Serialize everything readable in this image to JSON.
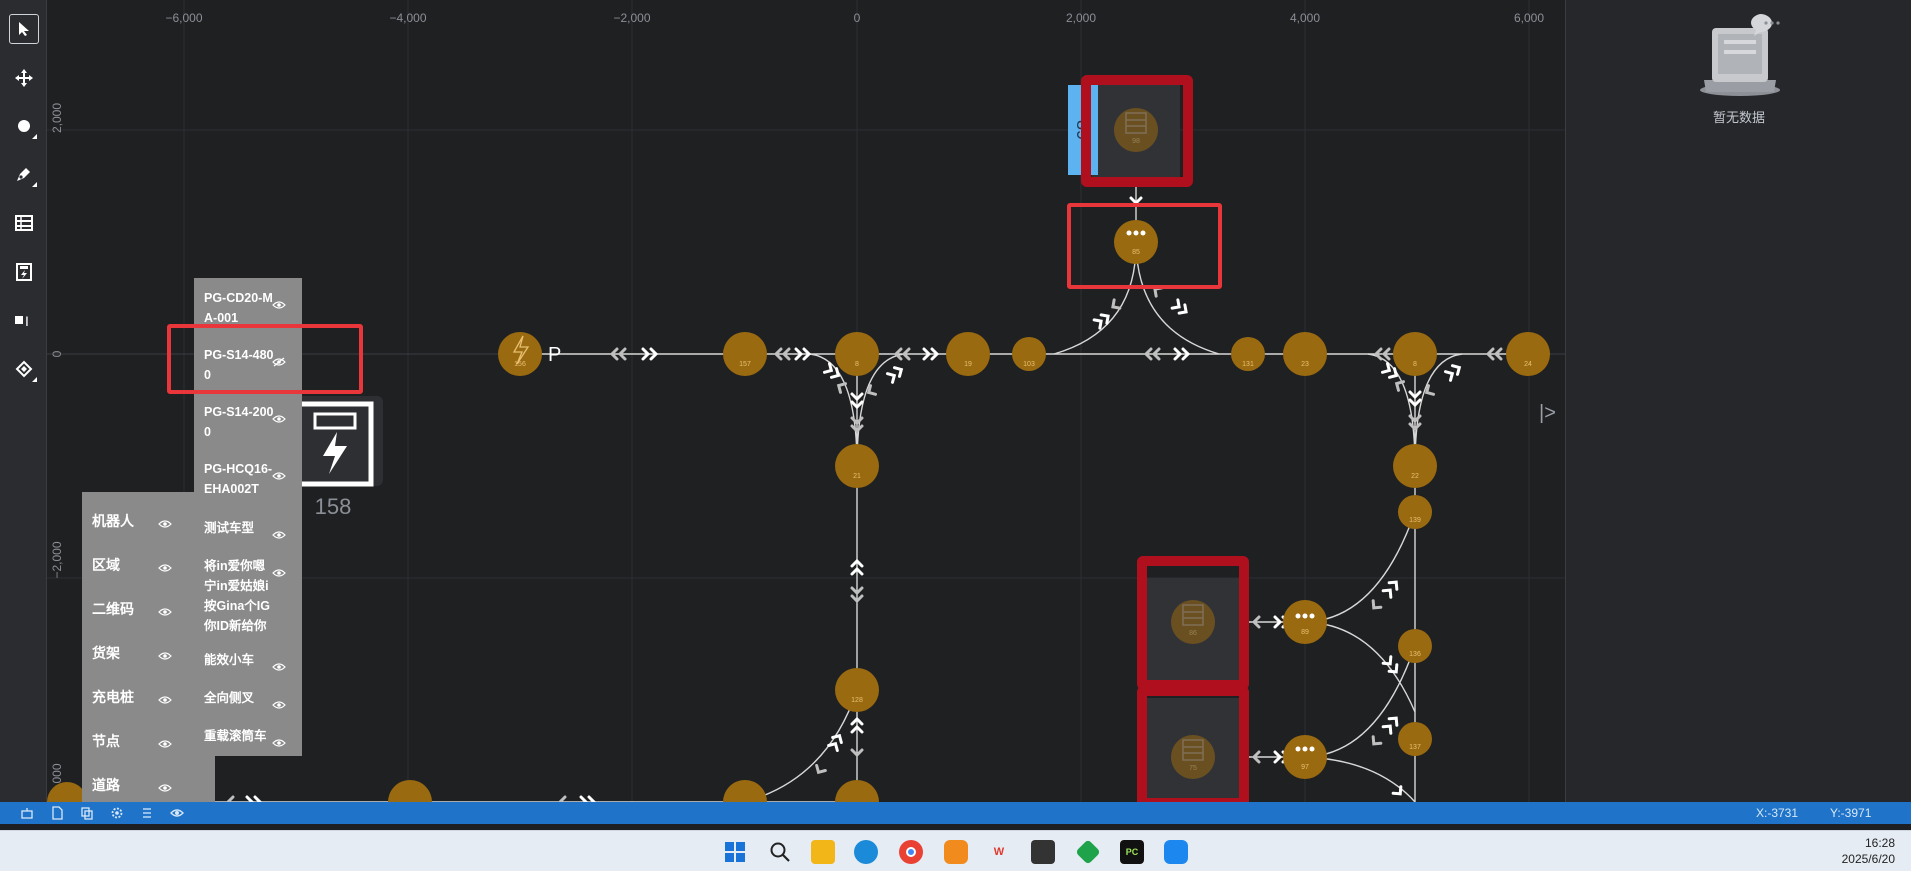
{
  "axes": {
    "x_ticks": [
      "−6,000",
      "−4,000",
      "−2,000",
      "0",
      "2,000",
      "4,000",
      "6,000"
    ],
    "y_ticks": [
      "2,000",
      "0",
      "−2,000",
      "−4,000"
    ]
  },
  "toolbar": {
    "tools": [
      "select-tool",
      "pan-tool",
      "point-tool",
      "pen-tool",
      "shelf-tool",
      "charger-tool",
      "label-tool",
      "area-tool"
    ]
  },
  "map": {
    "nodes": [
      {
        "label": "156",
        "icon": "charging-icon"
      },
      {
        "label": "157"
      },
      {
        "label": "8"
      },
      {
        "label": "19"
      },
      {
        "label": "103"
      },
      {
        "label": "131"
      },
      {
        "label": "23"
      },
      {
        "label": "8"
      },
      {
        "label": "24"
      },
      {
        "label": "21"
      },
      {
        "label": "22"
      },
      {
        "label": "139"
      },
      {
        "label": "98"
      },
      {
        "label": "86"
      },
      {
        "label": "89"
      },
      {
        "label": "136"
      },
      {
        "label": "85"
      },
      {
        "label": "75"
      },
      {
        "label": "97"
      },
      {
        "label": "137"
      },
      {
        "label": "128"
      }
    ],
    "charger_letter": "P",
    "charger_label": "158",
    "shelf_label": "89",
    "collapse_glyph": "|>"
  },
  "layers_left": [
    {
      "label": "机器人",
      "visible": true
    },
    {
      "label": "区域",
      "visible": true
    },
    {
      "label": "二维码",
      "visible": true
    },
    {
      "label": "货架",
      "visible": true
    },
    {
      "label": "充电桩",
      "visible": true
    },
    {
      "label": "节点",
      "visible": true
    },
    {
      "label": "道路",
      "visible": true
    }
  ],
  "layers_right": [
    {
      "label": "PG-CD20-MA-001",
      "visible": true
    },
    {
      "label": "PG-S14-4800",
      "visible": false
    },
    {
      "label": "PG-S14-2000",
      "visible": true
    },
    {
      "label": "PG-HCQ16-EHA002T",
      "visible": true
    },
    {
      "label": "测试车型",
      "visible": true
    },
    {
      "label": "将in爱你嗯宁in爱姑娘i按Gina个IG你ID新给你",
      "visible": true
    },
    {
      "label": "能效小车",
      "visible": true
    },
    {
      "label": "全向侧叉",
      "visible": true
    },
    {
      "label": "重载滚筒车",
      "visible": true
    }
  ],
  "right_panel": {
    "empty_text": "暂无数据"
  },
  "status": {
    "x": "X:-3731",
    "y": "Y:-3971"
  },
  "taskbar": {
    "time": "16:28",
    "date": "2025/6/20"
  },
  "colors": {
    "node": "#9a6a10",
    "highlight": "#e8363b",
    "dark_red": "#b0101d",
    "statusbar": "#1f74c9",
    "badge": "#5cb3f0"
  }
}
